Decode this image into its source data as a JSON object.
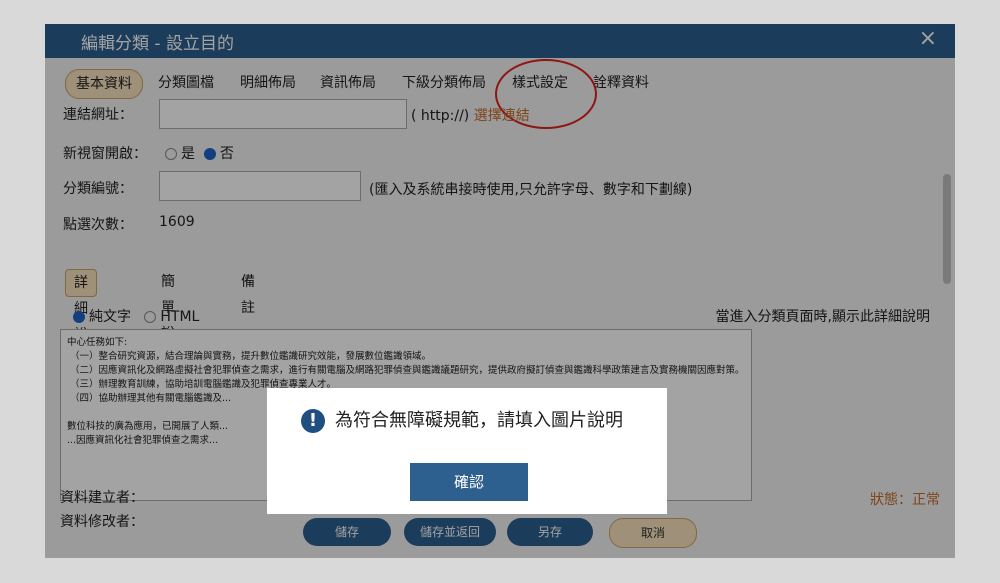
{
  "window": {
    "title": "編輯分類 - 設立目的",
    "close": "×"
  },
  "tabs": [
    {
      "label": "基本資料",
      "active": true
    },
    {
      "label": "分類圖檔"
    },
    {
      "label": "明細佈局"
    },
    {
      "label": "資訊佈局"
    },
    {
      "label": "下級分類佈局"
    },
    {
      "label": "樣式設定"
    },
    {
      "label": "詮釋資料"
    }
  ],
  "form": {
    "link_label": "連結網址：",
    "link_hint": "( http://)",
    "link_action": "選擇連結",
    "new_window_label": "新視窗開啟：",
    "new_window_yes": "是",
    "new_window_no": "否",
    "code_label": "分類編號：",
    "code_hint": "(匯入及系統串接時使用,只允許字母、數字和下劃線)",
    "clicks_label": "點選次數：",
    "clicks_value": "1609"
  },
  "subtabs": [
    {
      "label": "詳細說明",
      "active": true
    },
    {
      "label": "簡單說明"
    },
    {
      "label": "備　註"
    }
  ],
  "format": {
    "plain": "純文字",
    "html": "HTML",
    "note": "當進入分類頁面時,顯示此詳細說明"
  },
  "description": "中心任務如下:\n （一）整合研究資源，結合理論與實務，提升數位鑑識研究效能，發展數位鑑識領域。\n （二）因應資訊化及網路虛擬社會犯罪偵查之需求，進行有關電腦及網路犯罪偵查與鑑識議題研究，提供政府擬訂偵查與鑑識科學政策建言及實務機關因應對策。\n （三）辦理教育訓練，協助培訓電腦鑑識及犯罪偵查專業人才。\n （四）協助辦理其他有關電腦鑑識及...\n\n數位科技的廣為應用，已開展了人類...                                                         ...同善用數位科技及藉由數位系統跡證的輔助，重建...                                              ...因應資訊化社會犯罪偵查之需求...",
  "meta": {
    "created_label": "資料建立者：",
    "modified_label": "資料修改者：",
    "status": "狀態：正常"
  },
  "buttons": {
    "save": "儲存",
    "save_return": "儲存並返回",
    "save_as": "另存",
    "cancel": "取消"
  },
  "dialog": {
    "icon": "!",
    "message": "為符合無障礙規範，請填入圖片說明",
    "ok": "確認"
  }
}
